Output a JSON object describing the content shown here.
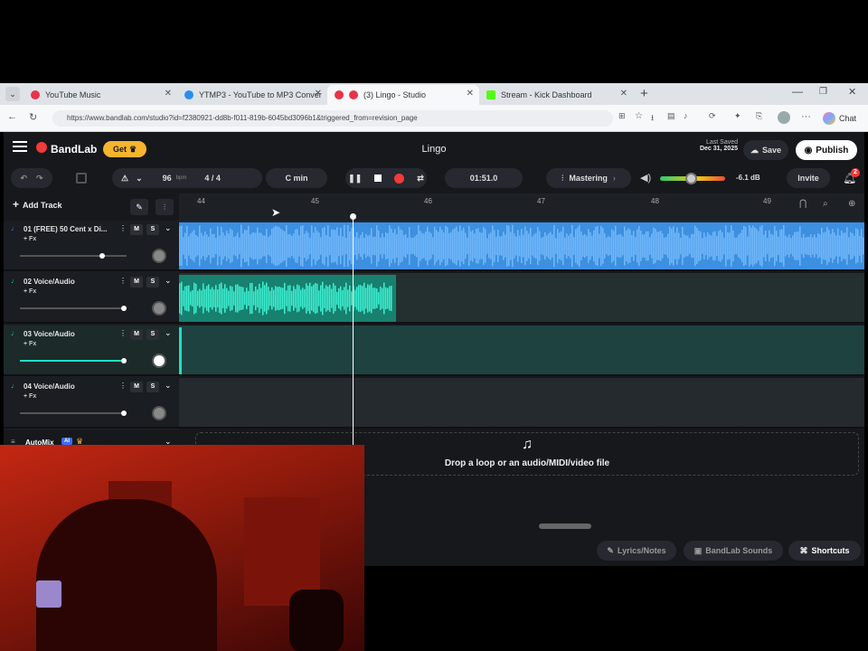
{
  "browser": {
    "tabs": [
      {
        "label": "YouTube Music",
        "color": "#e8334a"
      },
      {
        "label": "YTMP3 - YouTube to MP3 Conver",
        "color": "#2d8cf0"
      },
      {
        "label": "(3) Lingo - Studio",
        "color": "#e8334a"
      },
      {
        "label": "Stream - Kick Dashboard",
        "color": "#53fc18"
      }
    ],
    "url": "https://www.bandlab.com/studio?id=f2380921-dd8b-f011-819b-6045bd3096b1&triggered_from=revision_page",
    "profile_label": "Chat"
  },
  "app": {
    "brand": "BandLab",
    "get_label": "Get",
    "project_title": "Lingo",
    "last_saved_label": "Last Saved",
    "last_saved_date": "Dec 31, 2025",
    "save_label": "Save",
    "publish_label": "Publish",
    "tempo_value": "96",
    "tempo_unit": "bpm",
    "time_sig": "4 / 4",
    "key": "C min",
    "position": "01:51.0",
    "mastering_label": "Mastering",
    "volume_db": "-6.1 dB",
    "invite_label": "Invite",
    "notifications_count": "2",
    "add_track_label": "Add Track",
    "ruler_marks": [
      "44",
      "45",
      "46",
      "47",
      "48",
      "49"
    ],
    "tracks": [
      {
        "name": "01 (FREE) 50 Cent x Di...",
        "fx": "Fx",
        "color": "#3da0ff",
        "fader": 0.75
      },
      {
        "name": "02 Voice/Audio",
        "fx": "Fx",
        "color": "#1ee0c2",
        "fader": 0.98
      },
      {
        "name": "03 Voice/Audio",
        "fx": "Fx",
        "color": "#1ee0c2",
        "fader": 0.98
      },
      {
        "name": "04 Voice/Audio",
        "fx": "Fx",
        "color": "#1ee0c2",
        "fader": 0.98
      }
    ],
    "mute_label": "M",
    "solo_label": "S",
    "automix_label": "AutoMix",
    "ai_label": "AI",
    "drop_text": "Drop a loop or an audio/MIDI/video file",
    "bottom": {
      "lyrics_label": "Lyrics/Notes",
      "sounds_label": "BandLab Sounds",
      "shortcuts_label": "Shortcuts"
    }
  }
}
